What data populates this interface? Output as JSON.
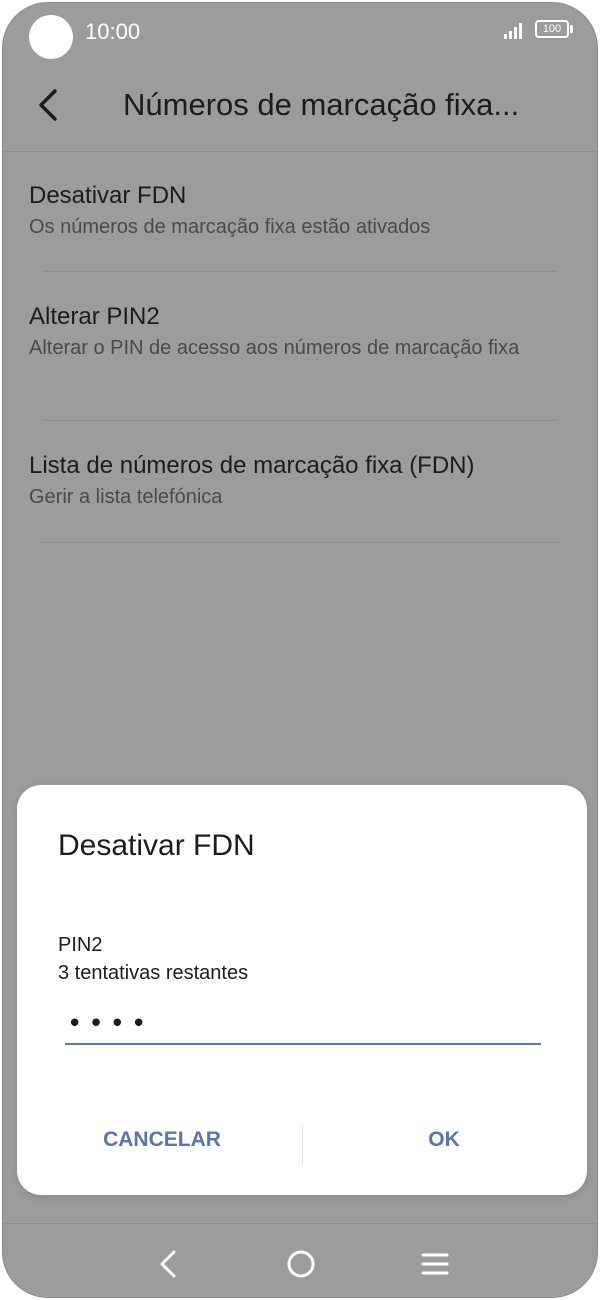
{
  "status_bar": {
    "time": "10:00",
    "battery_level": "100",
    "icons": [
      "signal-icon",
      "battery-icon"
    ]
  },
  "app_bar": {
    "title": "Números de marcação fixa...",
    "back_icon": "chevron-left-icon"
  },
  "settings": [
    {
      "title": "Desativar FDN",
      "subtitle": "Os números de marcação fixa estão ativados"
    },
    {
      "title": "Alterar PIN2",
      "subtitle": "Alterar o PIN de acesso aos números de marcação fixa"
    },
    {
      "title": "Lista de números de marcação fixa (FDN)",
      "subtitle": "Gerir a lista telefónica"
    }
  ],
  "dialog": {
    "title": "Desativar FDN",
    "label": "PIN2",
    "attempts": "3 tentativas restantes",
    "pin_value": "••••",
    "cancel_label": "CANCELAR",
    "ok_label": "OK"
  },
  "colors": {
    "accent": "#5b74ae",
    "scrim_background": "#9c9c9c",
    "dialog_background": "#ffffff"
  },
  "nav_bar": {
    "icons": [
      "nav-back-icon",
      "nav-home-icon",
      "nav-recents-icon"
    ]
  }
}
